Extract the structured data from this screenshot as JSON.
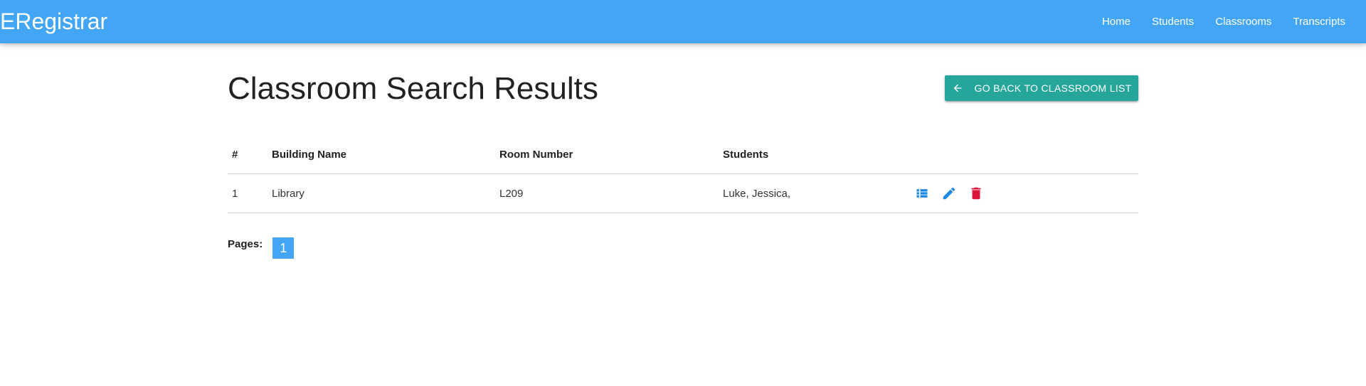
{
  "navbar": {
    "brand": "ERegistrar",
    "links": [
      "Home",
      "Students",
      "Classrooms",
      "Transcripts"
    ],
    "color": "#42a5f5"
  },
  "main": {
    "title": "Classroom Search Results",
    "back_button": {
      "label": "GO BACK TO CLASSROOM LIST",
      "icon": "arrow-left-icon",
      "color": "#26a69a"
    },
    "table": {
      "headers": [
        "#",
        "Building Name",
        "Room Number",
        "Students"
      ],
      "rows": [
        {
          "index": "1",
          "building": "Library",
          "room": "L209",
          "students": "Luke, Jessica,",
          "actions": [
            "list-icon",
            "edit-icon",
            "delete-icon"
          ]
        }
      ]
    },
    "pagination": {
      "label": "Pages:",
      "pages": [
        "1"
      ],
      "current": "1"
    }
  },
  "colors": {
    "list_icon": "#1e88e5",
    "edit_icon": "#1e88e5",
    "delete_icon": "#dc143c"
  }
}
